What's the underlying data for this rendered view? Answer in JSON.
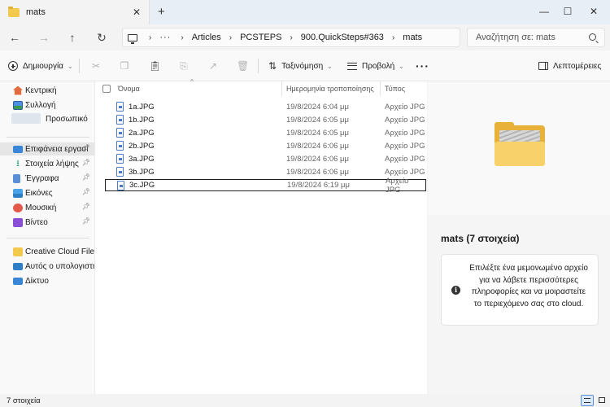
{
  "tab": {
    "title": "mats",
    "close_glyph": "✕",
    "new_tab_glyph": "+"
  },
  "window_controls": {
    "minimize": "—",
    "maximize": "☐",
    "close": "✕"
  },
  "nav": {
    "back": "←",
    "forward": "→",
    "up": "↑",
    "refresh": "↻"
  },
  "address": {
    "overflow": "···",
    "breadcrumbs": [
      "Articles",
      "PCSTEPS",
      "900.QuickSteps#363",
      "mats"
    ]
  },
  "search": {
    "placeholder": "Αναζήτηση σε: mats"
  },
  "commands": {
    "new_label": "Δημιουργία",
    "sort_label": "Ταξινόμηση",
    "view_label": "Προβολή",
    "more": "···",
    "details_label": "Λεπτομέρειες",
    "disabled_icons": [
      "cut-icon",
      "copy-icon",
      "paste-icon",
      "rename-icon",
      "share-icon",
      "delete-icon"
    ]
  },
  "sidebar": {
    "items": [
      {
        "label": "Κεντρική",
        "icon": "home-icon"
      },
      {
        "label": "Συλλογή",
        "icon": "gallery-icon"
      },
      {
        "label": "Προσωπικό",
        "icon": "cloud-icon"
      },
      {
        "label": "Επιφάνεια εργασί",
        "icon": "desktop-icon",
        "pinned": true,
        "selected": true
      },
      {
        "label": "Στοιχεία λήψης",
        "icon": "downloads-icon",
        "pinned": true
      },
      {
        "label": "Έγγραφα",
        "icon": "documents-icon",
        "pinned": true
      },
      {
        "label": "Εικόνες",
        "icon": "pictures-icon",
        "pinned": true
      },
      {
        "label": "Μουσική",
        "icon": "music-icon",
        "pinned": true
      },
      {
        "label": "Βίντεο",
        "icon": "videos-icon",
        "pinned": true
      },
      {
        "label": "Creative Cloud Files P",
        "icon": "creative-cloud-icon"
      },
      {
        "label": "Αυτός ο υπολογιστή",
        "icon": "this-pc-icon"
      },
      {
        "label": "Δίκτυο",
        "icon": "network-icon"
      }
    ]
  },
  "columns": {
    "name": "Όνομα",
    "date": "Ημερομηνία τροποποίησης",
    "type": "Τύπος"
  },
  "files": [
    {
      "name": "1a.JPG",
      "date": "19/8/2024 6:04 μμ",
      "type": "Αρχείο JPG"
    },
    {
      "name": "1b.JPG",
      "date": "19/8/2024 6:05 μμ",
      "type": "Αρχείο JPG"
    },
    {
      "name": "2a.JPG",
      "date": "19/8/2024 6:05 μμ",
      "type": "Αρχείο JPG"
    },
    {
      "name": "2b.JPG",
      "date": "19/8/2024 6:06 μμ",
      "type": "Αρχείο JPG"
    },
    {
      "name": "3a.JPG",
      "date": "19/8/2024 6:06 μμ",
      "type": "Αρχείο JPG"
    },
    {
      "name": "3b.JPG",
      "date": "19/8/2024 6:06 μμ",
      "type": "Αρχείο JPG"
    },
    {
      "name": "3c.JPG",
      "date": "19/8/2024 6:19 μμ",
      "type": "Αρχείο JPG",
      "focused": true
    }
  ],
  "details": {
    "title": "mats (7 στοιχεία)",
    "info_glyph": "i",
    "info": "Επιλέξτε ένα μεμονωμένο αρχείο για να λάβετε περισσότερες πληροφορίες και να μοιραστείτε το περιεχόμενο σας στο cloud."
  },
  "status": {
    "count": "7 στοιχεία",
    "active_view": "details"
  },
  "colors": {
    "folder": "#f9d16a",
    "accent": "#4b7bc8",
    "selected_bg": "#e6e6e6"
  }
}
